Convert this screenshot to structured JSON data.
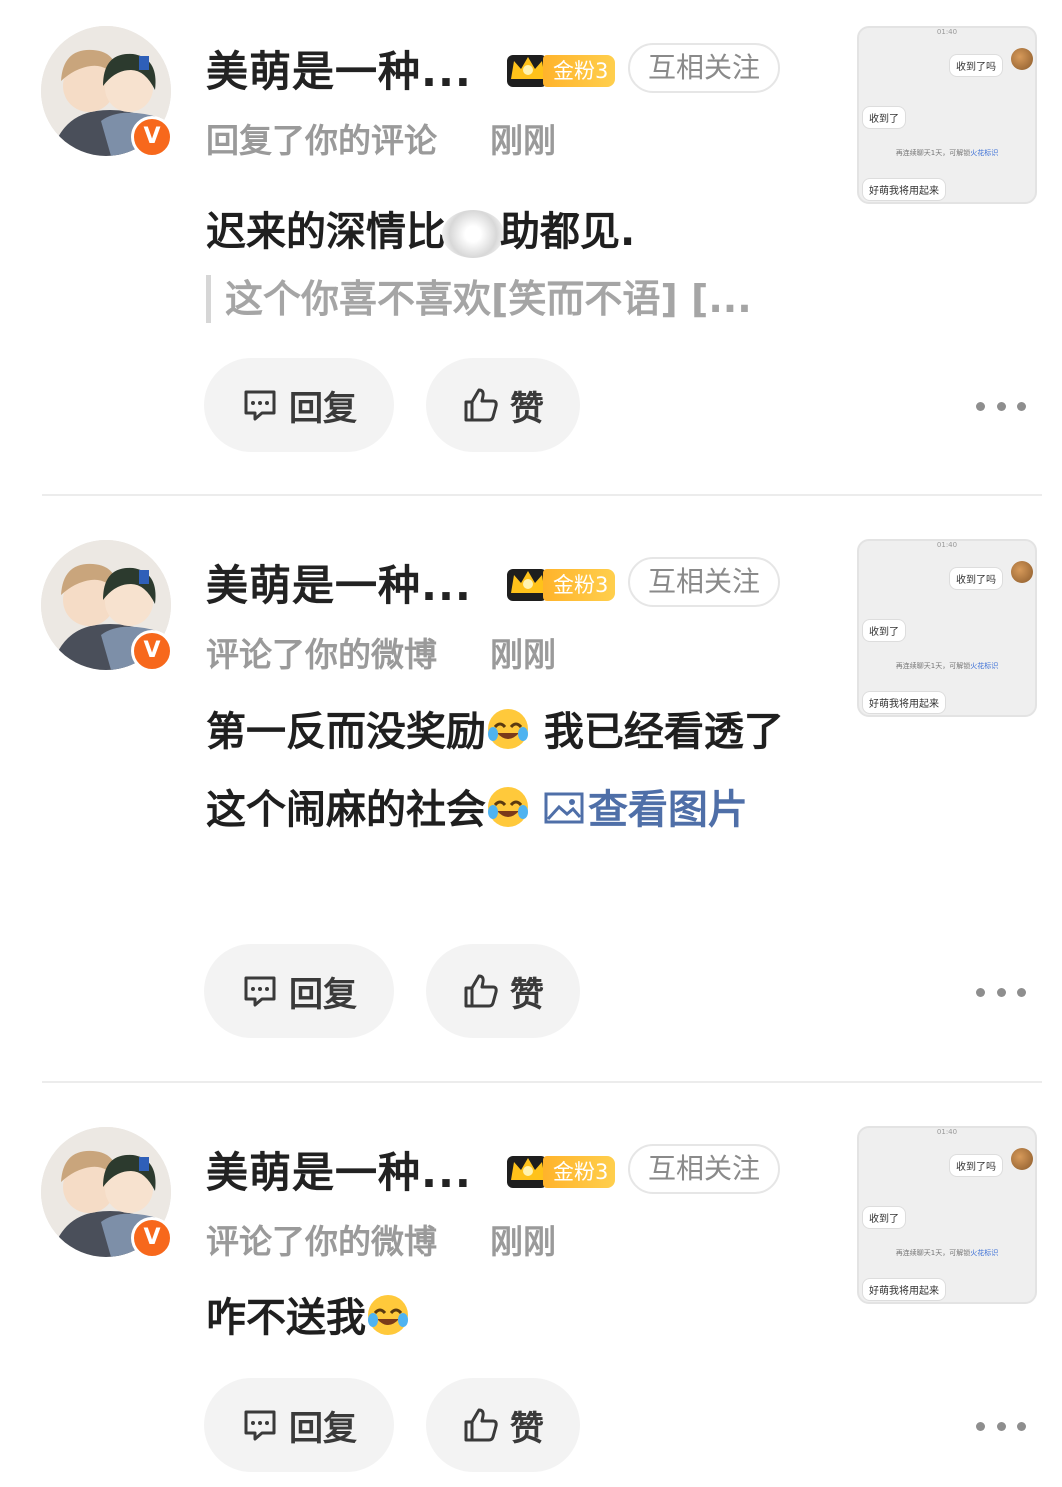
{
  "notifications": [
    {
      "name": "美萌是一种...",
      "fan_badge": "金粉3",
      "follow_label": "互相关注",
      "action": "回复了你的评论",
      "time": "刚刚",
      "content_a": "迟来的深情比",
      "content_b": "助都见.",
      "quote": "这个你喜不喜欢[笑而不语] [...",
      "reply_label": "回复",
      "like_label": "赞"
    },
    {
      "name": "美萌是一种...",
      "fan_badge": "金粉3",
      "follow_label": "互相关注",
      "action": "评论了你的微博",
      "time": "刚刚",
      "content_a": "第一反而没奖励",
      "content_b": " 我已经看透了这个闹麻的社会",
      "view_pic": "查看图片",
      "reply_label": "回复",
      "like_label": "赞"
    },
    {
      "name": "美萌是一种...",
      "fan_badge": "金粉3",
      "follow_label": "互相关注",
      "action": "评论了你的微博",
      "time": "刚刚",
      "content_a": "咋不送我",
      "reply_label": "回复",
      "like_label": "赞"
    }
  ],
  "thumbnail": {
    "time": "01:40",
    "bubble_1": "收到了吗",
    "bubble_2": "收到了",
    "system_a": "再连续聊天1天，可解锁",
    "system_b": "火花标识",
    "bubble_3": "好萌我将用起来"
  },
  "icons": {
    "verified": "verified-v-badge",
    "crown": "crown-icon",
    "reply": "comment-bubble-icon",
    "like": "thumbs-up-icon",
    "more": "more-dots-icon",
    "emoji": "laughing-crying-emoji",
    "picture": "picture-icon"
  },
  "colors": {
    "verified": "#f7681c",
    "fan_badge": "#ffb32b",
    "link": "#4f6fa8",
    "muted": "#9a9a9a"
  }
}
